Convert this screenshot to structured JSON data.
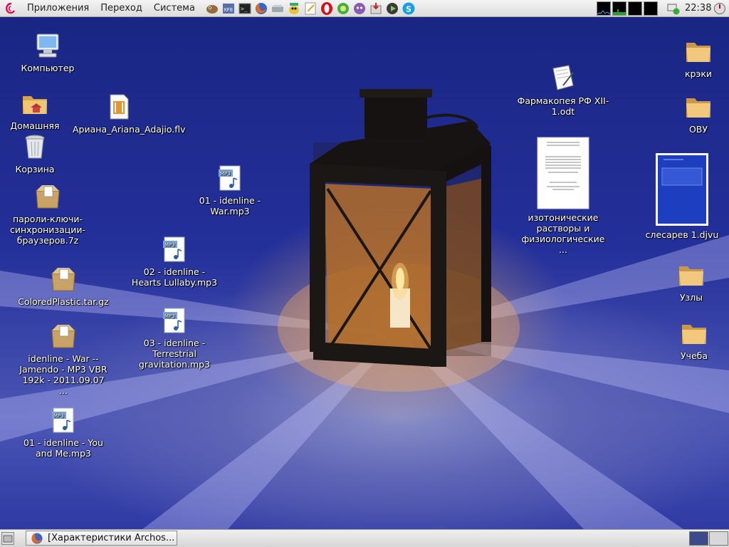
{
  "top_panel": {
    "menus": [
      "Приложения",
      "Переход",
      "Система"
    ],
    "launchers": [
      "gimp-icon",
      "xfe-icon",
      "terminal-icon",
      "firefox-icon",
      "scanner-icon",
      "pidgin-icon",
      "text-editor-icon",
      "opera-icon",
      "game-icon",
      "chat-icon",
      "archiver-icon",
      "media-player-icon",
      "skype-icon"
    ],
    "clock": "22:38"
  },
  "desktop_icons": {
    "computer": "Компьютер",
    "home": "Домашняя",
    "trash": "Корзина",
    "passwords_7z": "пароли-ключи-синхронизации-браузеров.7z",
    "colored_plastic": "ColoredPlastic.tar.gz",
    "idenline_war_jamendo": "idenline - War -- Jamendo - MP3 VBR 192k - 2011.09.07 ...",
    "you_and_me": "01 - idenline - You and Me.mp3",
    "ariana_flv": "Ариана_Ariana_Adajio.flv",
    "war_mp3": "01 - idenline - War.mp3",
    "hearts_lullaby": "02 - idenline - Hearts Lullaby.mp3",
    "terrestrial": "03 - idenline - Terrestrial gravitation.mp3",
    "farmakopeya": "Фармакопея РФ XII-1.odt",
    "isotonic": "изотонические растворы и физиологические ...",
    "kreki": "крэки",
    "ovu": "ОВУ",
    "slesarev": "слесарев 1.djvu",
    "uzly": "Узлы",
    "ucheba": "Учеба"
  },
  "bottom_panel": {
    "task": "[Характеристики Archos..."
  },
  "colors": {
    "panel": "#e6e6e6",
    "wallpaper_blue": "#24309a",
    "workspace_active": "#3c4a8a"
  }
}
